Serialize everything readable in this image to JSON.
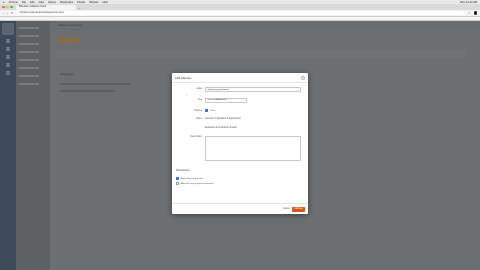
{
  "menubar": {
    "apple": "",
    "app_name": "Chrome",
    "items": [
      "File",
      "Edit",
      "View",
      "History",
      "Bookmarks",
      "People",
      "Window",
      "Help"
    ],
    "clock": "Mon 10:42 AM"
  },
  "browser": {
    "tab_title": "Bitbucket | Atlassian Cloud",
    "tab_add": "+",
    "url": "bitbucket.org/example/settings/access-keys",
    "nav_back": "‹",
    "nav_forward": "›",
    "nav_reload": "↻",
    "traffic_colors": [
      "#fe5f57",
      "#febc2e",
      "#28c840"
    ]
  },
  "app": {
    "breadcrumb": "Settings / Access keys",
    "section_title": "Access keys"
  },
  "modal": {
    "title": "Add SSH key",
    "close": "×",
    "fields": {
      "label_label": "Label",
      "label_value": "deploy-key-production",
      "key_label": "Key",
      "key_value": "ssh-rsa AAAAB3Nz...",
      "expires_label": "Expires",
      "expires_value": "Never",
      "check_label": "Read only",
      "notes_label": "Notes",
      "notes_value": "Used by CI pipeline for deployment",
      "notes_value_2": "Restricted to production branch",
      "description_label": "Description"
    },
    "permissions": {
      "title": "Permissions",
      "option_1": "Repository read access",
      "option_2": "Allow this key to push to branches"
    },
    "footer": {
      "cancel": "Cancel",
      "save": "Add key"
    }
  }
}
